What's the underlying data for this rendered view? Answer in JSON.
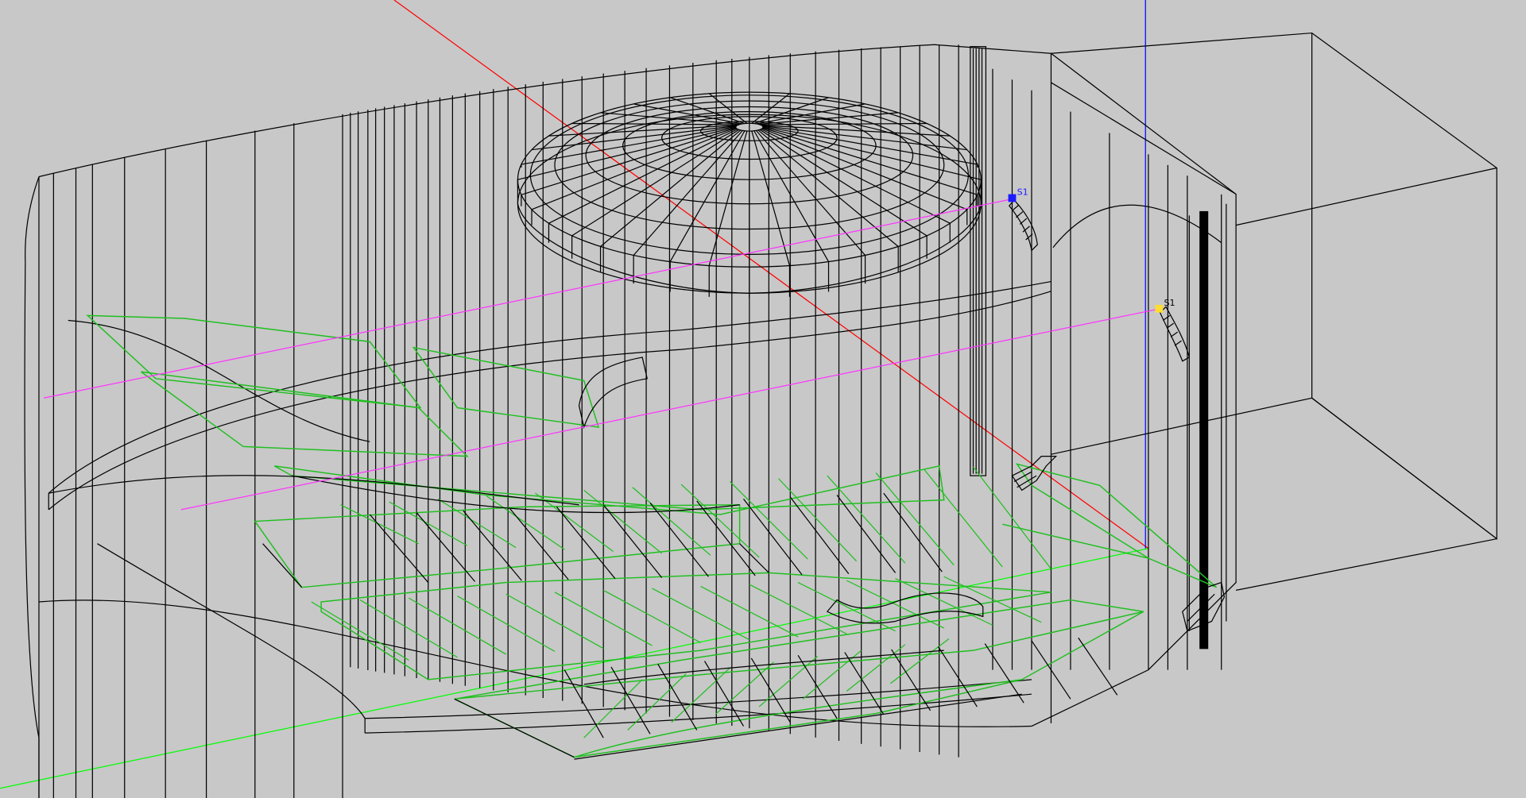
{
  "viewport": {
    "background": "#c8c8c8",
    "line_color": "#000000",
    "surface_color": "#1fbf1f",
    "axis_x_color": "#ff0000",
    "axis_y_color": "#00ff00",
    "axis_z_color": "#0000ff",
    "ray_color": "#ff33ff"
  },
  "sources": [
    {
      "label": "S1",
      "marker": "source-marker",
      "color": "#1a1aff"
    },
    {
      "label": "S1",
      "marker": "source-marker",
      "color": "#ffdd33"
    }
  ]
}
